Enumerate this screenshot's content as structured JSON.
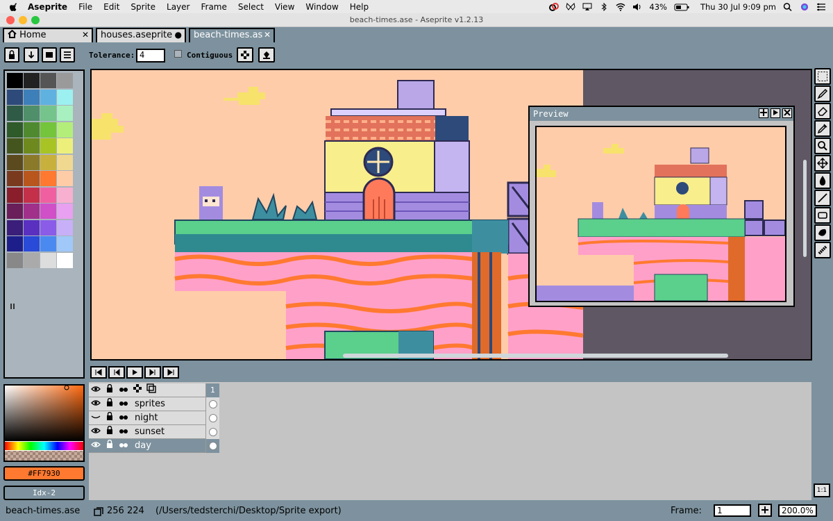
{
  "menubar": {
    "app_name": "Aseprite",
    "items": [
      "File",
      "Edit",
      "Sprite",
      "Layer",
      "Frame",
      "Select",
      "View",
      "Window",
      "Help"
    ],
    "battery": "43%",
    "clock": "Thu 30 Jul  9:09 pm"
  },
  "window": {
    "title": "beach-times.ase - Aseprite v1.2.13"
  },
  "tabs": [
    {
      "label": "Home",
      "icon": "home-icon",
      "close": "✕"
    },
    {
      "label": "houses.aseprite",
      "modified": "●"
    },
    {
      "label": "beach-times.as",
      "close": "✕"
    }
  ],
  "contextbar": {
    "tolerance_label": "Tolerance:",
    "tolerance_value": "4",
    "contiguous_label": "Contiguous"
  },
  "colors": {
    "fg_hex": "#FF7930",
    "bg_label": "Idx-2",
    "accent": "#7d929e",
    "sky": "#ffccaa"
  },
  "timeline": {
    "frame_header": "1",
    "layers": [
      {
        "name": "sprites",
        "visible": true
      },
      {
        "name": "night",
        "visible": false
      },
      {
        "name": "sunset",
        "visible": true
      },
      {
        "name": "day",
        "visible": true,
        "active": true
      }
    ]
  },
  "preview": {
    "title": "Preview"
  },
  "statusbar": {
    "filename": "beach-times.ase",
    "size": "256 224",
    "path": "(/Users/tedsterchi/Desktop/Sprite export)",
    "frame_label": "Frame:",
    "frame_value": "1",
    "zoom": "200.0%"
  },
  "ratio_label": "1:1"
}
